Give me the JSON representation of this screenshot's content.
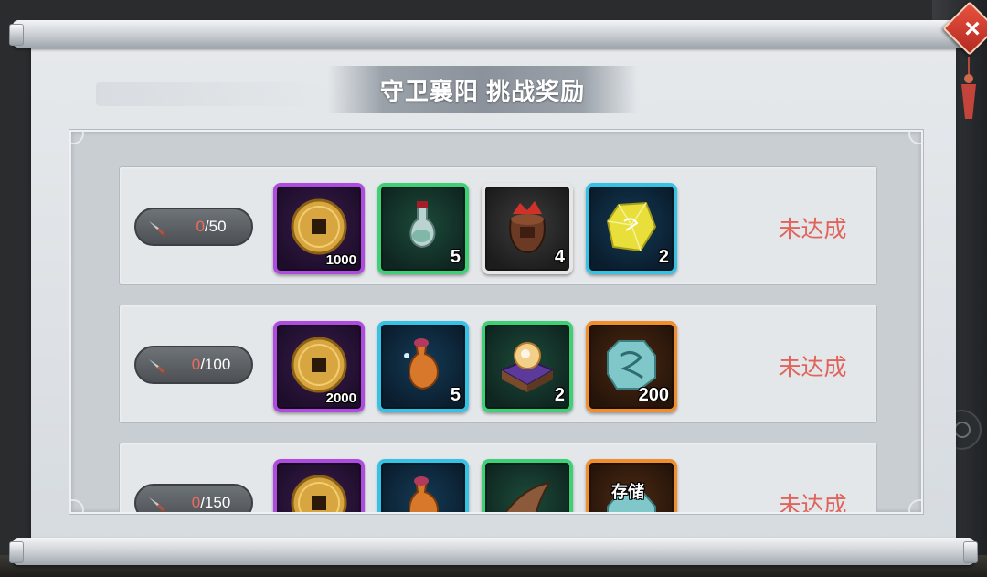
{
  "title": "守卫襄阳 挑战奖励",
  "close_label": "×",
  "status_color": "#e0645c",
  "rows": [
    {
      "progress_current": "0",
      "progress_sep_total": "/50",
      "status": "未达成",
      "items": [
        {
          "icon": "copper-coin-icon",
          "rarity": "purple",
          "count": "1000"
        },
        {
          "icon": "potion-flask-icon",
          "rarity": "green",
          "count": "5"
        },
        {
          "icon": "wine-jar-icon",
          "rarity": "white",
          "count": "4"
        },
        {
          "icon": "yellow-crystal-icon",
          "rarity": "blue",
          "count": "2"
        }
      ]
    },
    {
      "progress_current": "0",
      "progress_sep_total": "/100",
      "status": "未达成",
      "items": [
        {
          "icon": "copper-coin-icon",
          "rarity": "purple",
          "count": "2000"
        },
        {
          "icon": "elixir-gourd-icon",
          "rarity": "blue",
          "count": "5"
        },
        {
          "icon": "treasure-chest-orb-icon",
          "rarity": "green",
          "count": "2"
        },
        {
          "icon": "jade-token-icon",
          "rarity": "orange",
          "count": "200"
        }
      ]
    },
    {
      "progress_current": "0",
      "progress_sep_total": "/150",
      "status": "未达成",
      "items": [
        {
          "icon": "copper-coin-icon",
          "rarity": "purple",
          "count": ""
        },
        {
          "icon": "elixir-gourd-icon",
          "rarity": "blue",
          "count": ""
        },
        {
          "icon": "horn-icon",
          "rarity": "green",
          "count": ""
        },
        {
          "icon": "storage-token-icon",
          "rarity": "orange",
          "count": "",
          "label": "存储"
        }
      ]
    }
  ]
}
